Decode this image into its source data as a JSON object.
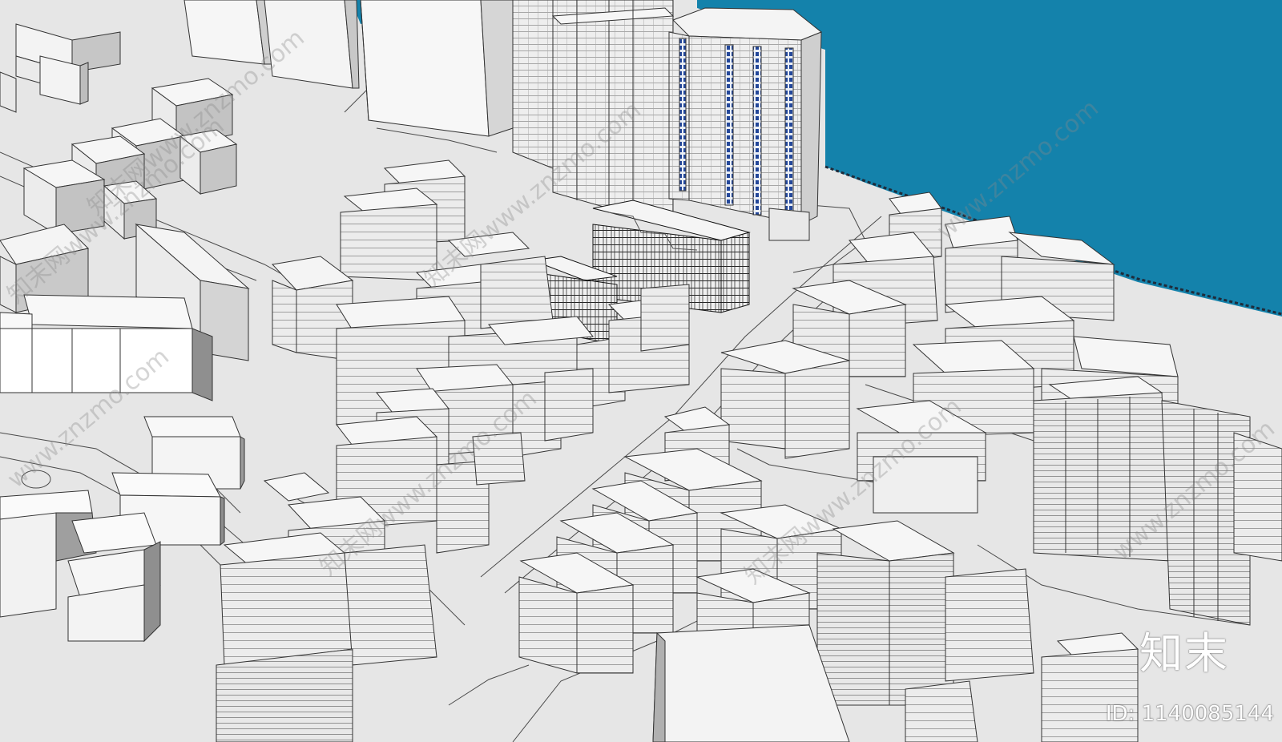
{
  "watermark": {
    "site": "www.znzmo.com",
    "site_cn": "知末网www.znzmo.com",
    "logo": "知末",
    "id_label": "ID: 1140085144"
  },
  "colors": {
    "ground": "#e6e6e6",
    "roof": "#f4f4f4",
    "wall_light": "#e9e9e9",
    "wall_shade": "#b9b9b9",
    "wall_dark": "#8e8e8e",
    "water": "#1482ab",
    "glass": "#1f3f8a",
    "edge": "#3a3a3a"
  }
}
